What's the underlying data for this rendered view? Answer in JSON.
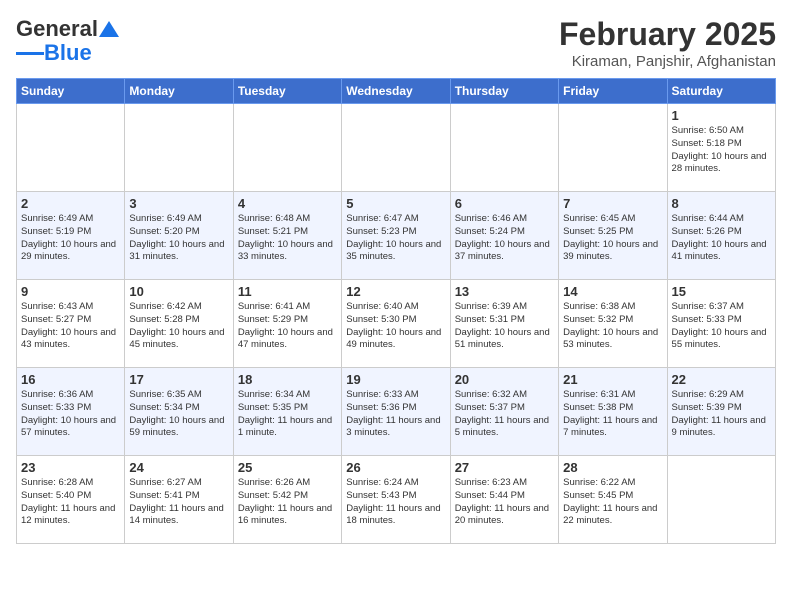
{
  "header": {
    "logo_general": "General",
    "logo_blue": "Blue",
    "month_title": "February 2025",
    "location": "Kiraman, Panjshir, Afghanistan"
  },
  "weekdays": [
    "Sunday",
    "Monday",
    "Tuesday",
    "Wednesday",
    "Thursday",
    "Friday",
    "Saturday"
  ],
  "weeks": [
    [
      {
        "day": "",
        "info": ""
      },
      {
        "day": "",
        "info": ""
      },
      {
        "day": "",
        "info": ""
      },
      {
        "day": "",
        "info": ""
      },
      {
        "day": "",
        "info": ""
      },
      {
        "day": "",
        "info": ""
      },
      {
        "day": "1",
        "info": "Sunrise: 6:50 AM\nSunset: 5:18 PM\nDaylight: 10 hours and 28 minutes."
      }
    ],
    [
      {
        "day": "2",
        "info": "Sunrise: 6:49 AM\nSunset: 5:19 PM\nDaylight: 10 hours and 29 minutes."
      },
      {
        "day": "3",
        "info": "Sunrise: 6:49 AM\nSunset: 5:20 PM\nDaylight: 10 hours and 31 minutes."
      },
      {
        "day": "4",
        "info": "Sunrise: 6:48 AM\nSunset: 5:21 PM\nDaylight: 10 hours and 33 minutes."
      },
      {
        "day": "5",
        "info": "Sunrise: 6:47 AM\nSunset: 5:23 PM\nDaylight: 10 hours and 35 minutes."
      },
      {
        "day": "6",
        "info": "Sunrise: 6:46 AM\nSunset: 5:24 PM\nDaylight: 10 hours and 37 minutes."
      },
      {
        "day": "7",
        "info": "Sunrise: 6:45 AM\nSunset: 5:25 PM\nDaylight: 10 hours and 39 minutes."
      },
      {
        "day": "8",
        "info": "Sunrise: 6:44 AM\nSunset: 5:26 PM\nDaylight: 10 hours and 41 minutes."
      }
    ],
    [
      {
        "day": "9",
        "info": "Sunrise: 6:43 AM\nSunset: 5:27 PM\nDaylight: 10 hours and 43 minutes."
      },
      {
        "day": "10",
        "info": "Sunrise: 6:42 AM\nSunset: 5:28 PM\nDaylight: 10 hours and 45 minutes."
      },
      {
        "day": "11",
        "info": "Sunrise: 6:41 AM\nSunset: 5:29 PM\nDaylight: 10 hours and 47 minutes."
      },
      {
        "day": "12",
        "info": "Sunrise: 6:40 AM\nSunset: 5:30 PM\nDaylight: 10 hours and 49 minutes."
      },
      {
        "day": "13",
        "info": "Sunrise: 6:39 AM\nSunset: 5:31 PM\nDaylight: 10 hours and 51 minutes."
      },
      {
        "day": "14",
        "info": "Sunrise: 6:38 AM\nSunset: 5:32 PM\nDaylight: 10 hours and 53 minutes."
      },
      {
        "day": "15",
        "info": "Sunrise: 6:37 AM\nSunset: 5:33 PM\nDaylight: 10 hours and 55 minutes."
      }
    ],
    [
      {
        "day": "16",
        "info": "Sunrise: 6:36 AM\nSunset: 5:33 PM\nDaylight: 10 hours and 57 minutes."
      },
      {
        "day": "17",
        "info": "Sunrise: 6:35 AM\nSunset: 5:34 PM\nDaylight: 10 hours and 59 minutes."
      },
      {
        "day": "18",
        "info": "Sunrise: 6:34 AM\nSunset: 5:35 PM\nDaylight: 11 hours and 1 minute."
      },
      {
        "day": "19",
        "info": "Sunrise: 6:33 AM\nSunset: 5:36 PM\nDaylight: 11 hours and 3 minutes."
      },
      {
        "day": "20",
        "info": "Sunrise: 6:32 AM\nSunset: 5:37 PM\nDaylight: 11 hours and 5 minutes."
      },
      {
        "day": "21",
        "info": "Sunrise: 6:31 AM\nSunset: 5:38 PM\nDaylight: 11 hours and 7 minutes."
      },
      {
        "day": "22",
        "info": "Sunrise: 6:29 AM\nSunset: 5:39 PM\nDaylight: 11 hours and 9 minutes."
      }
    ],
    [
      {
        "day": "23",
        "info": "Sunrise: 6:28 AM\nSunset: 5:40 PM\nDaylight: 11 hours and 12 minutes."
      },
      {
        "day": "24",
        "info": "Sunrise: 6:27 AM\nSunset: 5:41 PM\nDaylight: 11 hours and 14 minutes."
      },
      {
        "day": "25",
        "info": "Sunrise: 6:26 AM\nSunset: 5:42 PM\nDaylight: 11 hours and 16 minutes."
      },
      {
        "day": "26",
        "info": "Sunrise: 6:24 AM\nSunset: 5:43 PM\nDaylight: 11 hours and 18 minutes."
      },
      {
        "day": "27",
        "info": "Sunrise: 6:23 AM\nSunset: 5:44 PM\nDaylight: 11 hours and 20 minutes."
      },
      {
        "day": "28",
        "info": "Sunrise: 6:22 AM\nSunset: 5:45 PM\nDaylight: 11 hours and 22 minutes."
      },
      {
        "day": "",
        "info": ""
      }
    ]
  ]
}
